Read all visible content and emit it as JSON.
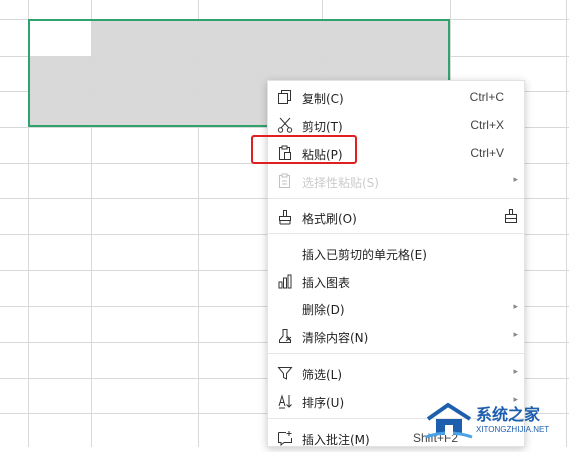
{
  "spreadsheet": {
    "columns": 6,
    "rows": 13,
    "selection_color": "#2fa36b",
    "selected_fill": "#d9d9d9"
  },
  "context_menu": {
    "items": [
      {
        "label": "复制(C)",
        "shortcut": "Ctrl+C",
        "icon": "copy-icon"
      },
      {
        "label": "剪切(T)",
        "shortcut": "Ctrl+X",
        "icon": "scissors-icon"
      },
      {
        "label": "粘贴(P)",
        "shortcut": "Ctrl+V",
        "icon": "paste-icon"
      },
      {
        "label": "选择性粘贴(S)",
        "icon": "paste-special-icon",
        "disabled": true,
        "submenu": true
      },
      {
        "label": "格式刷(O)",
        "icon": "format-painter-icon"
      },
      {
        "label": "插入已剪切的单元格(E)"
      },
      {
        "label": "插入图表",
        "icon": "chart-icon"
      },
      {
        "label": "删除(D)",
        "submenu": true
      },
      {
        "label": "清除内容(N)",
        "icon": "eraser-icon",
        "submenu": true
      },
      {
        "label": "筛选(L)",
        "icon": "filter-icon",
        "submenu": true
      },
      {
        "label": "排序(U)",
        "icon": "sort-icon",
        "submenu": true
      },
      {
        "label": "插入批注(M)",
        "shortcut": "Shift+F2",
        "icon": "comment-icon"
      }
    ],
    "highlight_color": "#e02020"
  },
  "watermark": {
    "title": "系统之家",
    "url": "XITONGZHIJIA.NET"
  }
}
